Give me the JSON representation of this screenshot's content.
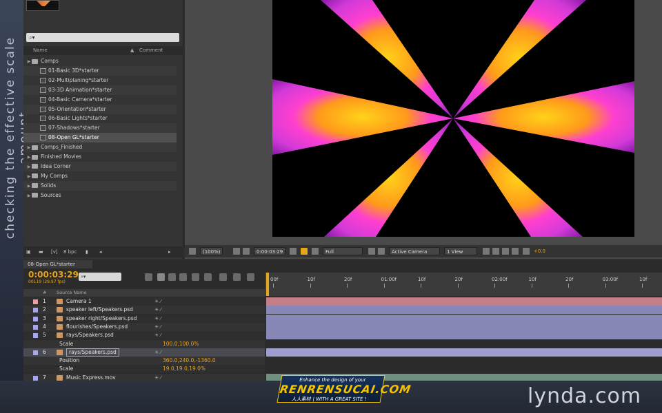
{
  "overlay": {
    "side_text": "checking the effective scale amount",
    "watermark_top": "Enhance the design of your",
    "watermark_main": "RENRENSUCAI.COM",
    "watermark_sub": "人人素材 | WITH A GREAT SITE !",
    "brand": "lynda.com"
  },
  "project": {
    "search_placeholder": "⌕▾",
    "col_name": "Name",
    "col_comment": "Comment",
    "items": [
      {
        "label": "Comps",
        "type": "folder"
      },
      {
        "label": "01-Basic 3D*starter",
        "type": "comp"
      },
      {
        "label": "02-Multiplaning*starter",
        "type": "comp"
      },
      {
        "label": "03-3D Animation*starter",
        "type": "comp"
      },
      {
        "label": "04-Basic Camera*starter",
        "type": "comp"
      },
      {
        "label": "05-Orientation*starter",
        "type": "comp"
      },
      {
        "label": "06-Basic Lights*starter",
        "type": "comp"
      },
      {
        "label": "07-Shadows*starter",
        "type": "comp"
      },
      {
        "label": "08-Open GL*starter",
        "type": "comp",
        "selected": true
      },
      {
        "label": "Comps_Finished",
        "type": "folder"
      },
      {
        "label": "Finished Movies",
        "type": "folder"
      },
      {
        "label": "Idea Corner",
        "type": "folder"
      },
      {
        "label": "My Comps",
        "type": "folder"
      },
      {
        "label": "Solids",
        "type": "folder"
      },
      {
        "label": "Sources",
        "type": "folder"
      }
    ],
    "footer_bpc": "8 bpc"
  },
  "viewer": {
    "zoom": "(100%)",
    "timecode": "0:00:03:29",
    "resolution": "Full",
    "camera": "Active Camera",
    "views": "1 View",
    "exposure": "+0.0"
  },
  "timeline": {
    "tab": "08-Open GL*starter",
    "timecode": "0:00:03:29",
    "fps": "00119 (29.97 fps)",
    "col_source": "Source Name",
    "ruler": [
      "00f",
      "10f",
      "20f",
      "01:00f",
      "10f",
      "20f",
      "02:00f",
      "10f",
      "20f",
      "03:00f",
      "10f"
    ],
    "layers": [
      {
        "num": "1",
        "name": "Camera 1",
        "label_color": "#e8a0a0",
        "bar_color": "#c47e88"
      },
      {
        "num": "2",
        "name": "speaker left/Speakers.psd",
        "label_color": "#a6a6e8",
        "bar_color": "#8787b8"
      },
      {
        "num": "3",
        "name": "speaker right/Speakers.psd",
        "label_color": "#a6a6e8",
        "bar_color": "#8787b8"
      },
      {
        "num": "4",
        "name": "flourishes/Speakers.psd",
        "label_color": "#a6a6e8",
        "bar_color": "#8787b8"
      },
      {
        "num": "5",
        "name": "rays/Speakers.psd",
        "label_color": "#a6a6e8",
        "bar_color": "#8787b8"
      },
      {
        "prop": "Scale",
        "value": "100.0,100.0%"
      },
      {
        "num": "6",
        "name": "rays/Speakers.psd",
        "label_color": "#a6a6e8",
        "bar_color": "#9d9dcf",
        "selected": true
      },
      {
        "prop": "Position",
        "value": "360.0,240.0,-1360.0"
      },
      {
        "prop": "Scale",
        "value": "19.0,19.0,19.0%"
      },
      {
        "num": "7",
        "name": "Music Express.mov",
        "label_color": "#a6a6e8",
        "bar_color": "#6f8f7f"
      }
    ]
  }
}
